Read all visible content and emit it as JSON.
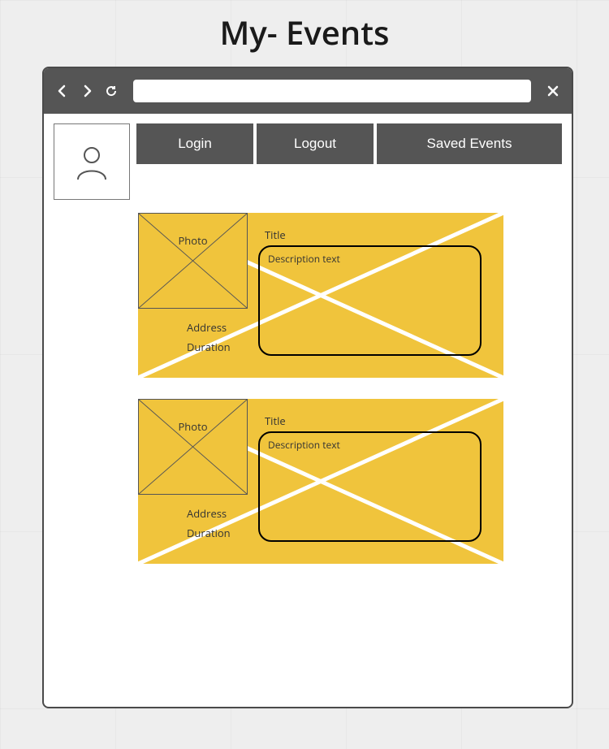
{
  "page_title": "My- Events",
  "chrome": {
    "url_value": ""
  },
  "nav": {
    "login": "Login",
    "logout": "Logout",
    "saved": "Saved Events"
  },
  "cards": [
    {
      "photo_label": "Photo",
      "address_label": "Address",
      "duration_label": "Duration",
      "title_label": "Title",
      "description_label": "Description text"
    },
    {
      "photo_label": "Photo",
      "address_label": "Address",
      "duration_label": "Duration",
      "title_label": "Title",
      "description_label": "Description text"
    }
  ],
  "colors": {
    "card_bg": "#f0c43c",
    "chrome_bg": "#555555"
  }
}
